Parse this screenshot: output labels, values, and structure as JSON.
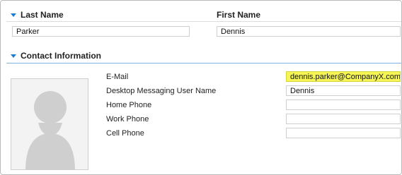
{
  "name_section": {
    "last_name_header": "Last Name",
    "first_name_header": "First Name",
    "last_name_value": "Parker",
    "first_name_value": "Dennis"
  },
  "contact_section": {
    "header": "Contact Information",
    "fields": [
      {
        "label": "E-Mail",
        "value": "dennis.parker@CompanyX.com"
      },
      {
        "label": "Desktop Messaging User Name",
        "value": "Dennis"
      },
      {
        "label": "Home Phone",
        "value": ""
      },
      {
        "label": "Work Phone",
        "value": ""
      },
      {
        "label": "Cell Phone",
        "value": ""
      }
    ]
  },
  "icons": {
    "avatar": "person-silhouette-icon",
    "collapse": "triangle-down-icon"
  },
  "colors": {
    "accent": "#1d7bd2",
    "highlight": "#f5f556"
  }
}
